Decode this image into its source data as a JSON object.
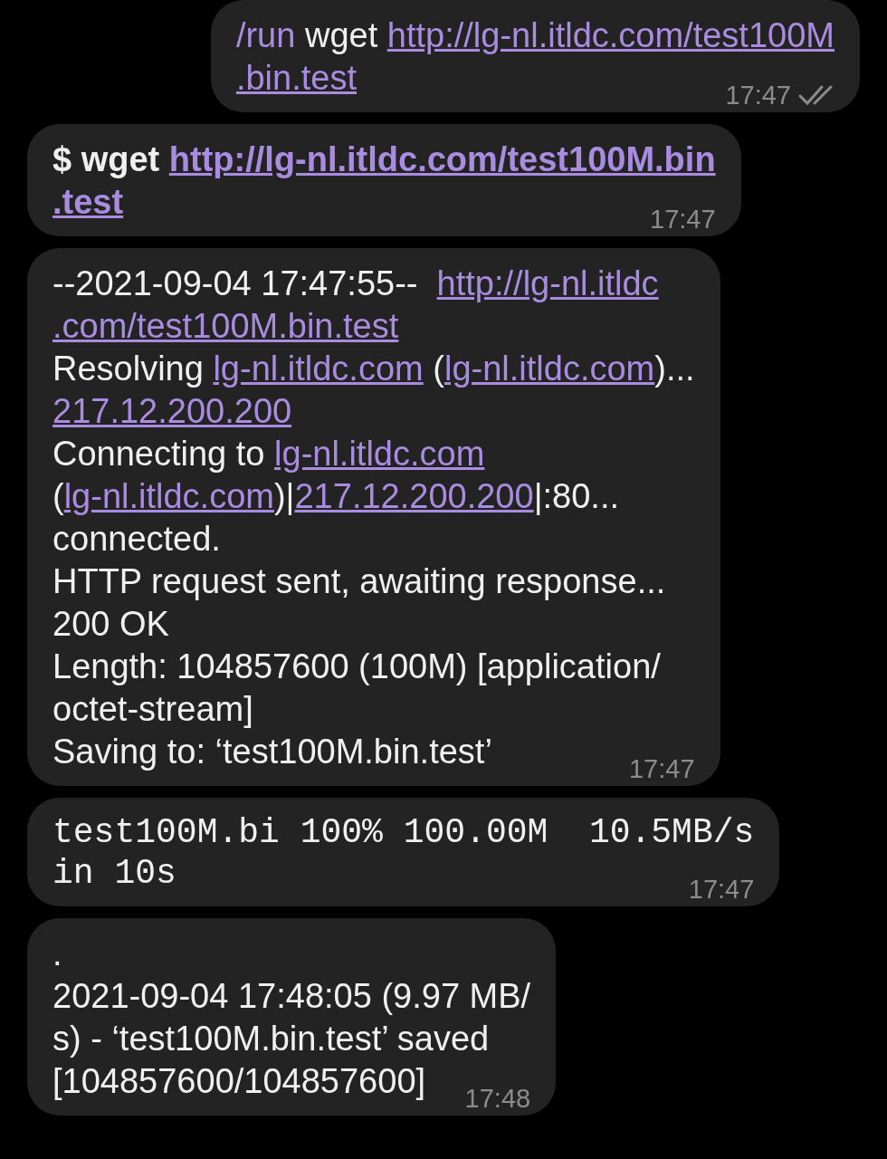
{
  "messages": [
    {
      "outgoing": true,
      "kind": "text",
      "bold": false,
      "time": "17:47",
      "read": true,
      "lines": [
        [
          {
            "text": "/run",
            "kind": "command"
          },
          {
            "text": " wget ",
            "kind": "plain"
          },
          {
            "text": "http://lg-nl.itldc.com/test100M",
            "kind": "link"
          }
        ],
        [
          {
            "text": ".bin.test",
            "kind": "link"
          }
        ]
      ]
    },
    {
      "outgoing": false,
      "kind": "text",
      "bold": true,
      "time": "17:47",
      "lines": [
        [
          {
            "text": "$ wget ",
            "kind": "plain"
          },
          {
            "text": "http://lg-nl.itldc.com/test100M.bin",
            "kind": "link"
          }
        ],
        [
          {
            "text": ".test",
            "kind": "link"
          }
        ]
      ]
    },
    {
      "outgoing": false,
      "kind": "text",
      "bold": false,
      "time": "17:47",
      "lines": [
        [
          {
            "text": "--2021-09-04 17:47:55--  ",
            "kind": "plain"
          },
          {
            "text": "http://lg-nl.itldc",
            "kind": "link"
          }
        ],
        [
          {
            "text": ".com/test100M.bin.test",
            "kind": "link"
          }
        ],
        [
          {
            "text": "Resolving ",
            "kind": "plain"
          },
          {
            "text": "lg-nl.itldc.com",
            "kind": "link"
          },
          {
            "text": " (",
            "kind": "plain"
          },
          {
            "text": "lg-nl.itldc.com",
            "kind": "link"
          },
          {
            "text": ")...",
            "kind": "plain"
          }
        ],
        [
          {
            "text": "217.12.200.200",
            "kind": "link"
          }
        ],
        [
          {
            "text": "Connecting to ",
            "kind": "plain"
          },
          {
            "text": "lg-nl.itldc.com",
            "kind": "link"
          }
        ],
        [
          {
            "text": "(",
            "kind": "plain"
          },
          {
            "text": "lg-nl.itldc.com",
            "kind": "link"
          },
          {
            "text": ")|",
            "kind": "plain"
          },
          {
            "text": "217.12.200.200",
            "kind": "link"
          },
          {
            "text": "|:80...",
            "kind": "plain"
          }
        ],
        [
          {
            "text": "connected.",
            "kind": "plain"
          }
        ],
        [
          {
            "text": "HTTP request sent, awaiting response...",
            "kind": "plain"
          }
        ],
        [
          {
            "text": "200 OK",
            "kind": "plain"
          }
        ],
        [
          {
            "text": "Length: 104857600 (100M) [application/",
            "kind": "plain"
          }
        ],
        [
          {
            "text": "octet-stream]",
            "kind": "plain"
          }
        ],
        [
          {
            "text": "Saving to: ‘test100M.bin.test’",
            "kind": "plain"
          }
        ]
      ]
    },
    {
      "outgoing": false,
      "kind": "code",
      "bold": false,
      "time": "17:47",
      "lines": [
        [
          {
            "text": "test100M.bi 100% 100.00M  10.5MB/s",
            "kind": "plain"
          }
        ],
        [
          {
            "text": "in 10s",
            "kind": "plain"
          }
        ]
      ]
    },
    {
      "outgoing": false,
      "kind": "text",
      "bold": false,
      "time": "17:48",
      "lines": [
        [
          {
            "text": ".",
            "kind": "plain"
          }
        ],
        [
          {
            "text": "2021-09-04 17:48:05 (9.97 MB/",
            "kind": "plain"
          }
        ],
        [
          {
            "text": "s) - ‘test100M.bin.test’ saved",
            "kind": "plain"
          }
        ],
        [
          {
            "text": "[104857600/104857600]",
            "kind": "plain"
          }
        ]
      ]
    }
  ]
}
